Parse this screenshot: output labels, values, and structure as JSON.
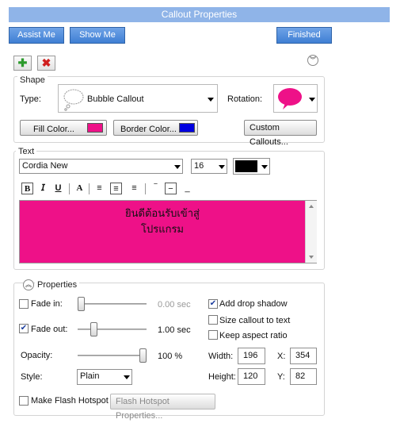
{
  "window": {
    "title": "Callout Properties"
  },
  "toolbar": {
    "assist_label": "Assist Me",
    "show_label": "Show Me",
    "finished_label": "Finished"
  },
  "shape": {
    "legend": "Shape",
    "type_label": "Type:",
    "type_value": "Bubble Callout",
    "rotation_label": "Rotation:",
    "fill_label": "Fill Color...",
    "fill_color": "#ee1188",
    "border_label": "Border Color...",
    "border_color": "#0000e0",
    "custom_label": "Custom Callouts..."
  },
  "text": {
    "legend": "Text",
    "font": "Cordia New",
    "size": "16",
    "color": "#000000",
    "content_line1": "ยินดีต้อนรับเข้าสู่",
    "content_line2": "โปรแกรม",
    "background": "#ee1188"
  },
  "properties": {
    "legend": "Properties",
    "fade_in_label": "Fade in:",
    "fade_in_checked": false,
    "fade_in_value": "0.00 sec",
    "fade_out_label": "Fade out:",
    "fade_out_checked": true,
    "fade_out_value": "1.00 sec",
    "opacity_label": "Opacity:",
    "opacity_value": "100 %",
    "style_label": "Style:",
    "style_value": "Plain",
    "drop_shadow_label": "Add drop shadow",
    "drop_shadow_checked": true,
    "size_to_text_label": "Size callout to text",
    "size_to_text_checked": false,
    "keep_aspect_label": "Keep aspect ratio",
    "keep_aspect_checked": false,
    "width_label": "Width:",
    "width_value": "196",
    "height_label": "Height:",
    "height_value": "120",
    "x_label": "X:",
    "x_value": "354",
    "y_label": "Y:",
    "y_value": "82",
    "flash_hotspot_label": "Make Flash Hotspot",
    "flash_props_label": "Flash Hotspot Properties..."
  }
}
